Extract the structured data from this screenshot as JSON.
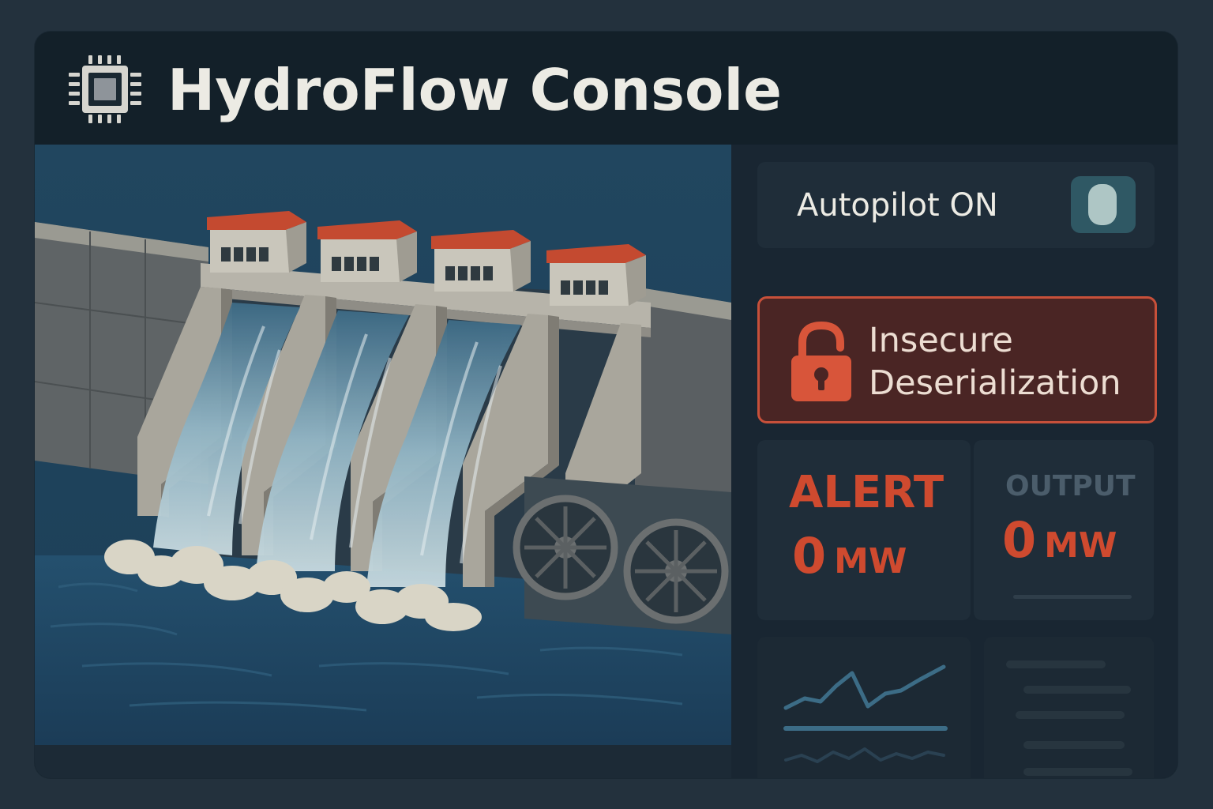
{
  "header": {
    "title": "HydroFlow Console",
    "icon": "chip-icon"
  },
  "scene": {
    "icon": "hydro-dam-illustration"
  },
  "autopilot": {
    "label": "Autopilot ON",
    "state": "on"
  },
  "vulnerability": {
    "line1": "Insecure",
    "line2": "Deserialization",
    "icon": "unlocked-padlock-icon"
  },
  "alert": {
    "label": "ALERT",
    "value": "0",
    "unit": "MW"
  },
  "output": {
    "label": "OUTPUT",
    "value": "0",
    "unit": "MW"
  },
  "colors": {
    "background": "#23313d",
    "panel": "#15222d",
    "accent_alert": "#cf4a2f",
    "vuln_border": "#c7503a",
    "vuln_fill": "#4a2524",
    "toggle_track": "#2f5864",
    "toggle_knob": "#aec6c5",
    "water": "#1f4662",
    "roof": "#c44a30"
  }
}
